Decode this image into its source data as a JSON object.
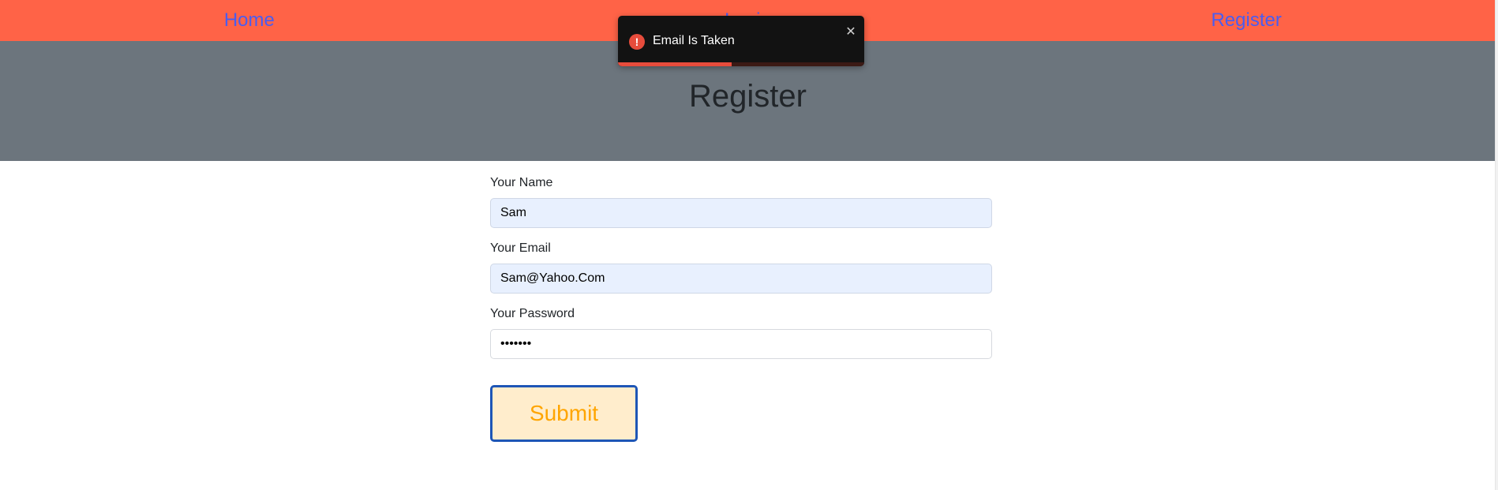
{
  "nav": {
    "links": [
      {
        "label": "Home"
      },
      {
        "label": "Login"
      },
      {
        "label": "Register"
      }
    ]
  },
  "banner": {
    "title": "Register"
  },
  "form": {
    "name": {
      "label": "Your Name",
      "value": "Sam"
    },
    "email": {
      "label": "Your Email",
      "value": "Sam@Yahoo.Com"
    },
    "password": {
      "label": "Your Password",
      "value": "•••••••"
    },
    "submit_label": "Submit"
  },
  "toast": {
    "message": "Email Is Taken",
    "icon": "alert-circle-icon",
    "close_icon": "close-icon",
    "progress_fraction": 0.46,
    "colors": {
      "background": "#121212",
      "accent": "#e74c3c"
    }
  },
  "colors": {
    "navbar": "#ff6347",
    "nav_link": "#4a5cf0",
    "banner": "#6c757d",
    "submit_bg": "#ffedcc",
    "submit_border": "#1e56b6",
    "submit_text": "#ffa500",
    "autofill_bg": "#e8f0fe"
  }
}
